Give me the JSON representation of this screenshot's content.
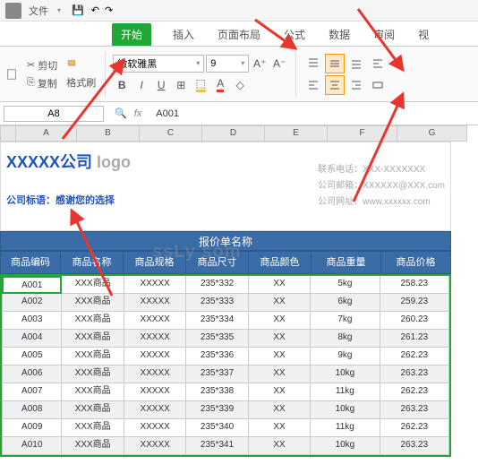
{
  "menubar": {
    "file": "文件",
    "dd": "▾"
  },
  "tabs": {
    "start": "开始",
    "insert": "插入",
    "layout": "页面布局",
    "formula": "公式",
    "data": "数据",
    "review": "审阅",
    "view": "视"
  },
  "ribbon": {
    "cut": "剪切",
    "copy": "复制",
    "fmtpaint": "格式刷",
    "font": "微软雅黑",
    "size": "9",
    "bold": "B",
    "italic": "I",
    "underline": "U"
  },
  "namebox": "A8",
  "fx": "fx",
  "fxval": "A001",
  "cols": {
    "A": "A",
    "B": "B",
    "C": "C",
    "D": "D",
    "E": "E",
    "F": "F",
    "G": "G"
  },
  "header": {
    "company": "XXXXX公司",
    "logo": "logo",
    "slogan": "公司标语：感谢您的选择",
    "phone": "联系电话：XXX-XXXXXXX",
    "email": "公司邮箱：XXXXXX@XXX.com",
    "web": "公司网址：www.xxxxxx.com"
  },
  "quote_title": "报价单名称",
  "thdr": {
    "c1": "商品编码",
    "c2": "商品名称",
    "c3": "商品规格",
    "c4": "商品尺寸",
    "c5": "商品颜色",
    "c6": "商品重量",
    "c7": "商品价格"
  },
  "chart_data": {
    "type": "table",
    "columns": [
      "商品编码",
      "商品名称",
      "商品规格",
      "商品尺寸",
      "商品颜色",
      "商品重量",
      "商品价格"
    ],
    "rows": [
      [
        "A001",
        "XXX商品",
        "XXXXX",
        "235*332",
        "XX",
        "5kg",
        "258.23"
      ],
      [
        "A002",
        "XXX商品",
        "XXXXX",
        "235*333",
        "XX",
        "6kg",
        "259.23"
      ],
      [
        "A003",
        "XXX商品",
        "XXXXX",
        "235*334",
        "XX",
        "7kg",
        "260.23"
      ],
      [
        "A004",
        "XXX商品",
        "XXXXX",
        "235*335",
        "XX",
        "8kg",
        "261.23"
      ],
      [
        "A005",
        "XXX商品",
        "XXXXX",
        "235*336",
        "XX",
        "9kg",
        "262.23"
      ],
      [
        "A006",
        "XXX商品",
        "XXXXX",
        "235*337",
        "XX",
        "10kg",
        "263.23"
      ],
      [
        "A007",
        "XXX商品",
        "XXXXX",
        "235*338",
        "XX",
        "11kg",
        "262.23"
      ],
      [
        "A008",
        "XXX商品",
        "XXXXX",
        "235*339",
        "XX",
        "10kg",
        "263.23"
      ],
      [
        "A009",
        "XXX商品",
        "XXXXX",
        "235*340",
        "XX",
        "11kg",
        "262.23"
      ],
      [
        "A010",
        "XXX商品",
        "XXXXX",
        "235*341",
        "XX",
        "10kg",
        "263.23"
      ]
    ]
  },
  "watermark": "ssLy som"
}
